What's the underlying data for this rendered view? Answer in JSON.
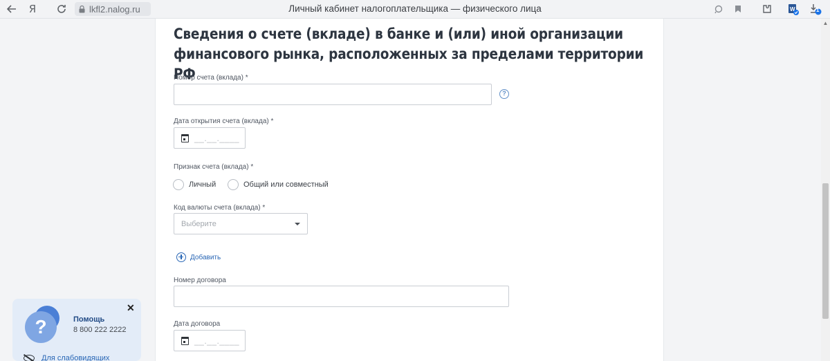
{
  "browser": {
    "url": "lkfl2.nalog.ru",
    "title": "Личный кабинет налогоплательщика — физического лица",
    "download_badge": "1"
  },
  "form": {
    "heading": "Сведения о счете (вкладе) в банке и (или) иной организации финансового рынка, расположенных за пределами территории РФ",
    "account_number": {
      "label": "Номер счета (вклада) *",
      "value": ""
    },
    "open_date": {
      "label": "Дата открытия счета (вклада) *",
      "placeholder": "__.__.____"
    },
    "account_type": {
      "label": "Признак счета (вклада) *",
      "options": [
        "Личный",
        "Общий или совместный"
      ]
    },
    "currency": {
      "label": "Код валюты счета (вклада) *",
      "placeholder": "Выберите"
    },
    "add_label": "Добавить",
    "contract_number": {
      "label": "Номер договора",
      "value": ""
    },
    "contract_date": {
      "label": "Дата договора",
      "placeholder": "__.__.____"
    }
  },
  "help_widget": {
    "badge": "?",
    "title": "Помощь",
    "phone": "8 800 222 2222",
    "close": "✕",
    "vision_link": "Для слабовидящих"
  },
  "colors": {
    "accent": "#2866b5",
    "help_bg": "#e3ecf8"
  }
}
